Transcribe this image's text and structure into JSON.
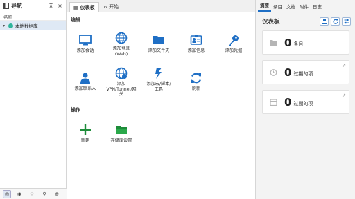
{
  "nav": {
    "title": "导航",
    "column_header": "名称",
    "database_name": "本地数据库",
    "bottom_buttons": [
      "summary",
      "record",
      "star",
      "search",
      "globe"
    ]
  },
  "tabs": [
    {
      "label": "仪表板",
      "active": true
    },
    {
      "label": "开始",
      "active": false
    }
  ],
  "main": {
    "edit_section": "编辑",
    "edit_tiles": [
      {
        "label": "添加会话",
        "icon": "monitor-icon"
      },
      {
        "label": "添加登录\n(Web)",
        "icon": "globe-icon"
      },
      {
        "label": "添加文件夹",
        "icon": "folder-icon"
      },
      {
        "label": "添加信息",
        "icon": "contact-card-icon"
      },
      {
        "label": "添加凭据",
        "icon": "key-icon"
      },
      {
        "label": "添加联系人",
        "icon": "person-icon"
      },
      {
        "label": "添加\nVPN/Tunnel/网\n关",
        "icon": "vpn-globe-icon"
      },
      {
        "label": "添加宏/脚本/\n工具",
        "icon": "macro-icon"
      },
      {
        "label": "刷新",
        "icon": "refresh-icon"
      }
    ],
    "actions_section": "操作",
    "action_tiles": [
      {
        "label": "新建",
        "icon": "plus-icon"
      },
      {
        "label": "存储库设置",
        "icon": "repository-folder-icon"
      }
    ]
  },
  "right_panel": {
    "tabs": [
      "摘要",
      "条目",
      "文档",
      "附件",
      "日志"
    ],
    "active_tab": "摘要",
    "dashboard_title": "仪表板",
    "cards": [
      {
        "count": "0",
        "unit": "条目",
        "icon": "entries-icon"
      },
      {
        "count": "0",
        "unit": "过期的项",
        "icon": "alarm-icon"
      },
      {
        "count": "0",
        "unit": "过期的项",
        "icon": "calendar-icon"
      }
    ]
  },
  "colors": {
    "accent_blue": "#1f6fc5",
    "green": "#1e8c3a",
    "teal_dot": "#2fb59c",
    "selection": "#dfe9f5"
  }
}
